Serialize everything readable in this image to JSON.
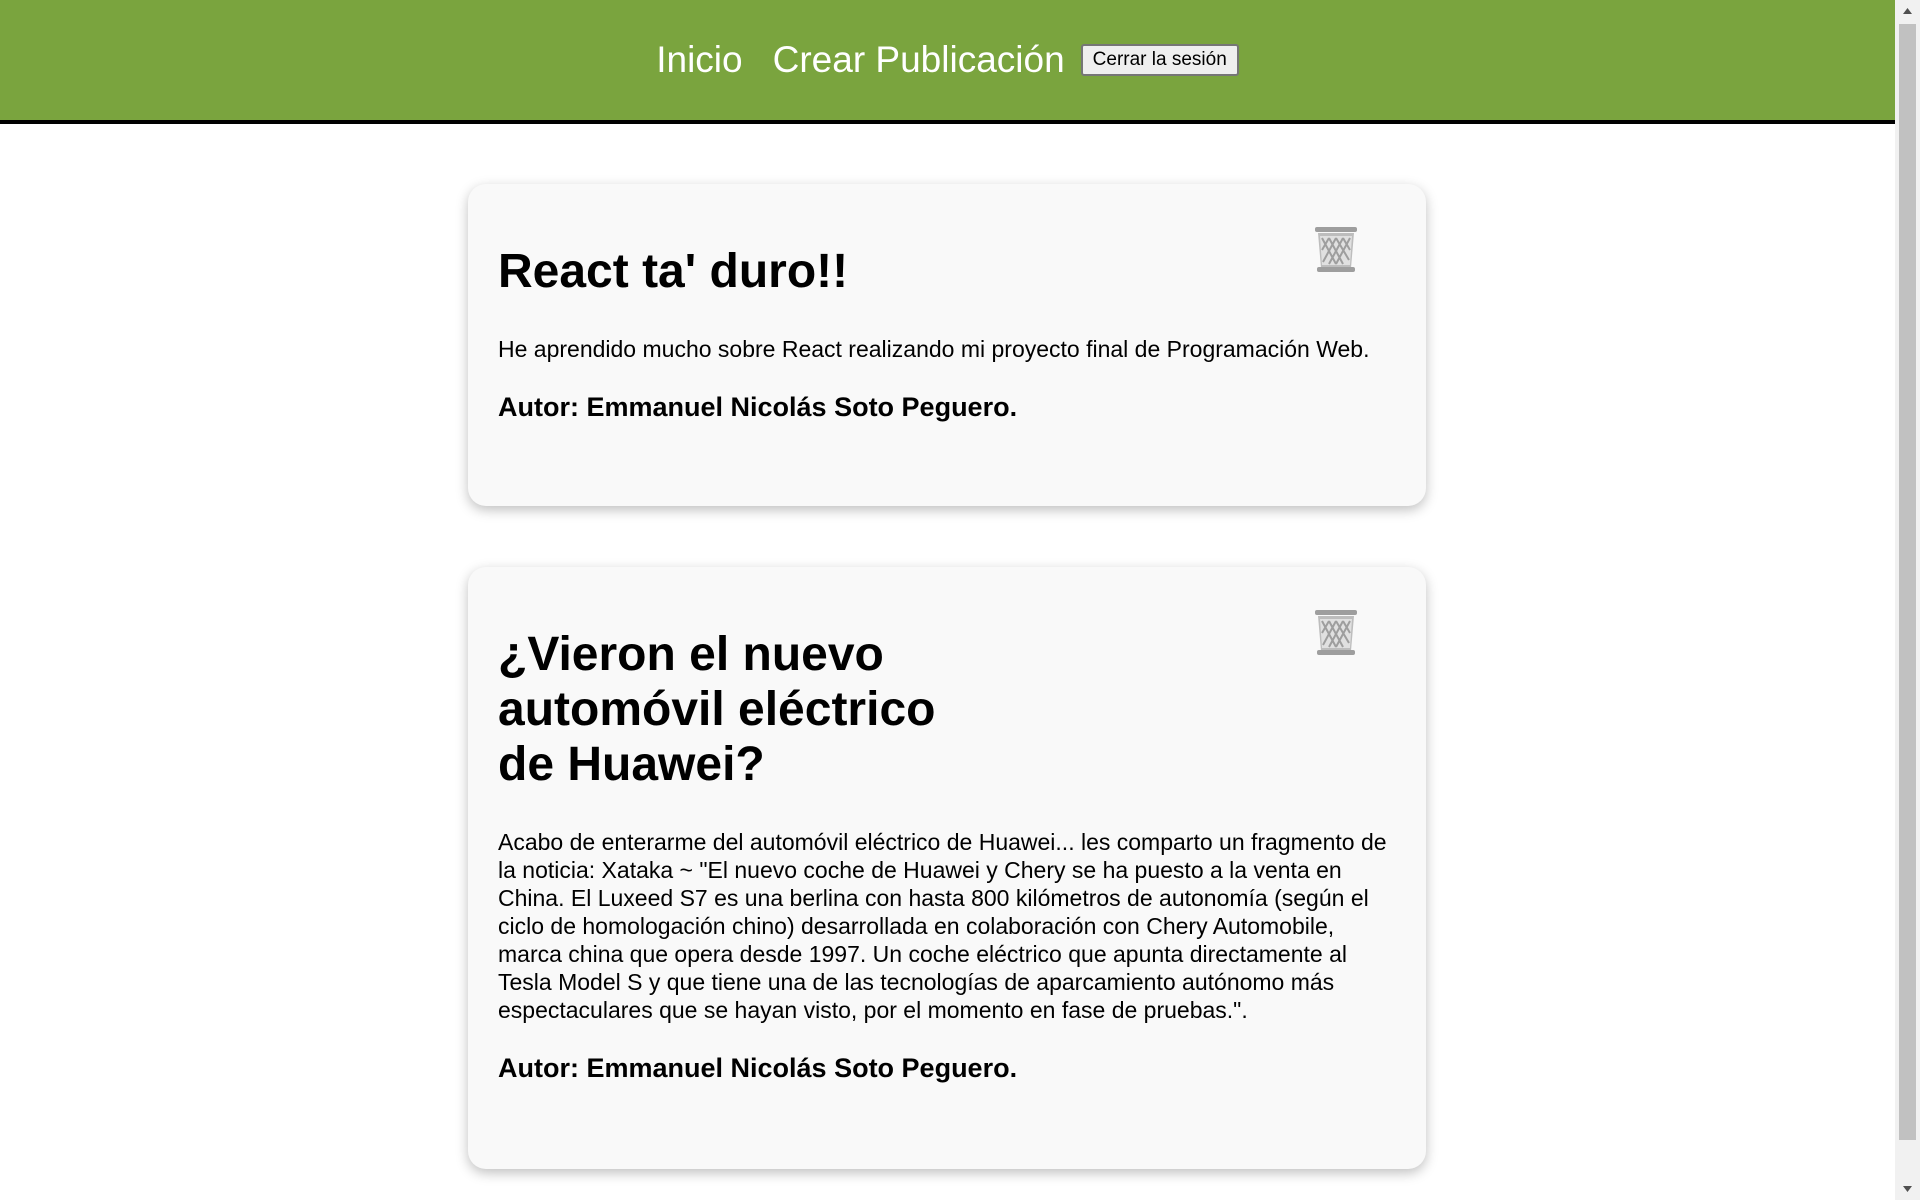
{
  "navbar": {
    "home_label": "Inicio",
    "create_label": "Crear Publicación",
    "logout_label": "Cerrar la sesión",
    "background_color": "#7aa43e"
  },
  "posts": [
    {
      "title": "React ta' duro!!",
      "body": "He aprendido mucho sobre React realizando mi proyecto final de Programación Web.",
      "author": "Autor: Emmanuel Nicolás Soto Peguero.",
      "delete_icon": "trash-icon"
    },
    {
      "title": "¿Vieron el nuevo automóvil eléctrico de Huawei?",
      "body": "Acabo de enterarme del automóvil eléctrico de Huawei... les comparto un fragmento de la noticia: Xataka ~ \"El nuevo coche de Huawei y Chery se ha puesto a la venta en China. El Luxeed S7 es una berlina con hasta 800 kilómetros de autonomía (según el ciclo de homologación chino) desarrollada en colaboración con Chery Automobile, marca china que opera desde 1997. Un coche eléctrico que apunta directamente al Tesla Model S y que tiene una de las tecnologías de aparcamiento autónomo más espectaculares que se hayan visto, por el momento en fase de pruebas.\".",
      "author": "Autor: Emmanuel Nicolás Soto Peguero.",
      "delete_icon": "trash-icon"
    }
  ]
}
